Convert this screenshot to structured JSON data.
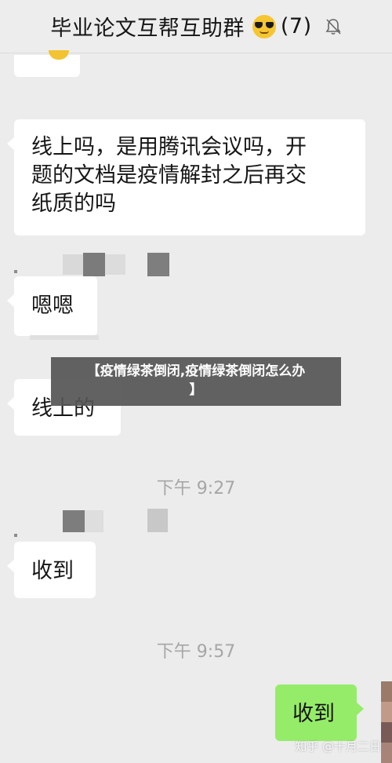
{
  "header": {
    "title": "毕业论文互帮互助群",
    "emoji": "sunglasses-emoji",
    "count": "(7)",
    "mute_icon": "bell-mute-icon"
  },
  "messages": {
    "m1": "线上吗，是用腾讯会议吗，开题的文档是疫情解封之后再交纸质的吗",
    "m1_lines": [
      "线上吗，是用腾讯会议吗，开",
      "题的文档是疫情解封之后再交",
      "纸质的吗"
    ],
    "m2": "嗯嗯",
    "m3": "线上的",
    "m4": "收到",
    "m5": "收到"
  },
  "timestamps": {
    "t1": "下午 9:27",
    "t2": "下午 9:57"
  },
  "overlay": {
    "line1": "【疫情绿茶倒闭,疫情绿茶倒闭怎么办",
    "line2": "】"
  },
  "watermark": "知乎 @十月二日",
  "colors": {
    "background": "#ececec",
    "incoming_bubble": "#ffffff",
    "outgoing_bubble": "#95ec69",
    "timestamp": "#a6a6a6"
  }
}
